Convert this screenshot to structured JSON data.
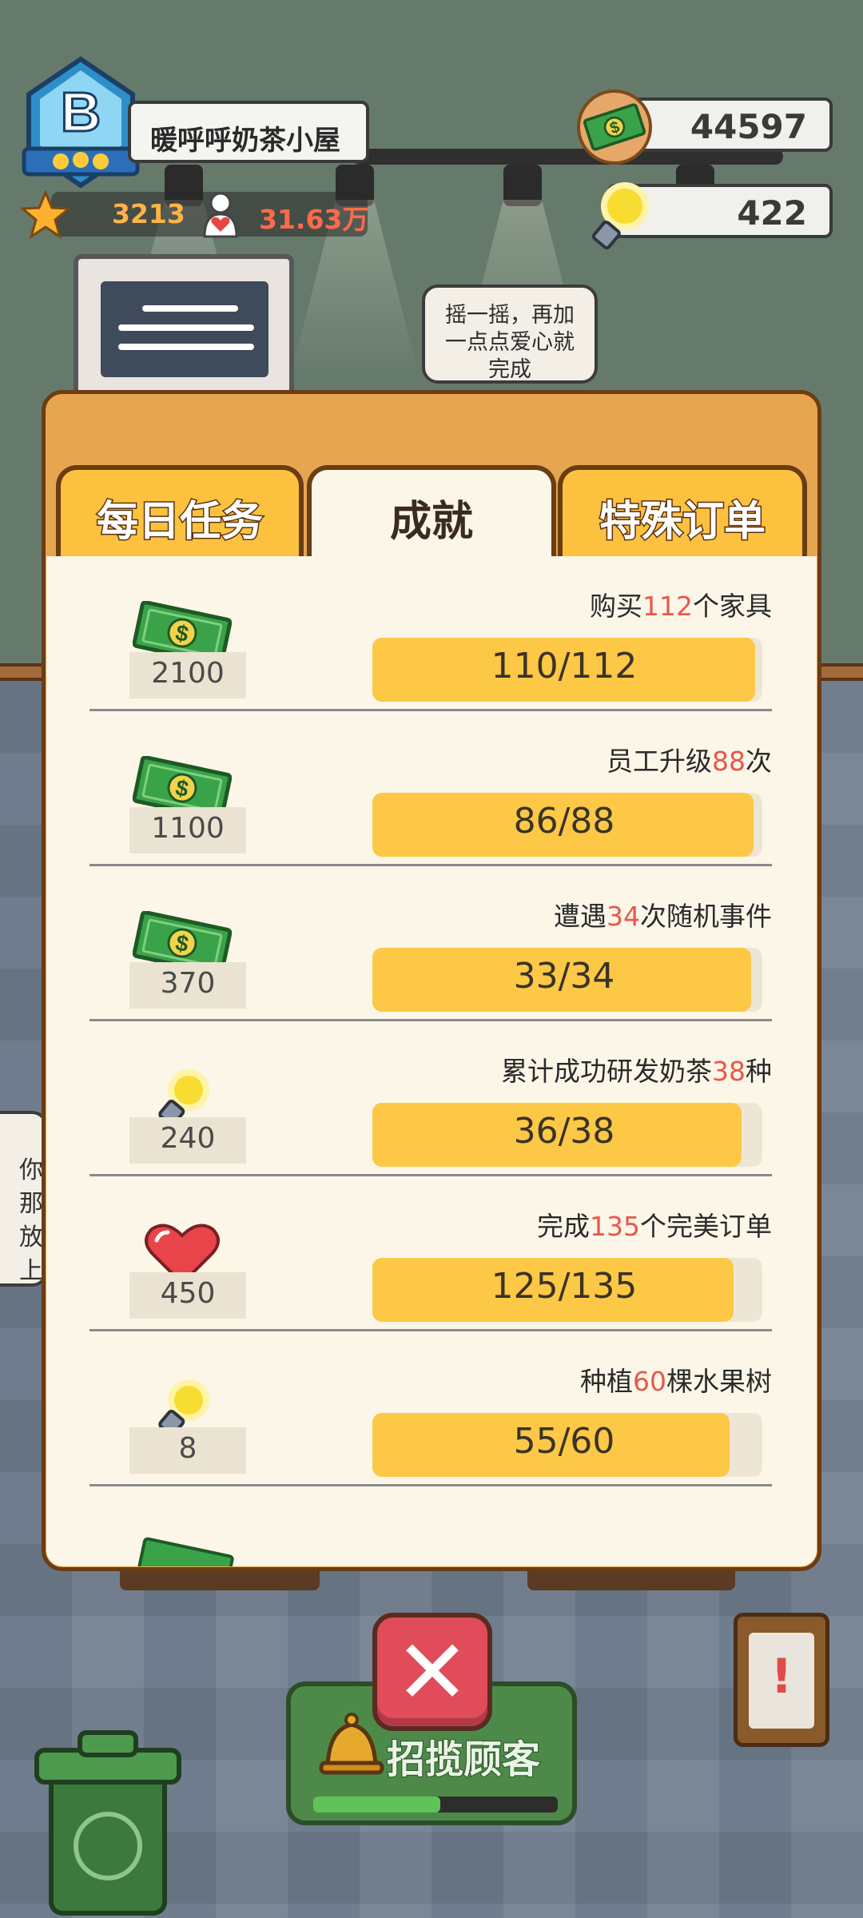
{
  "header": {
    "rank_letter": "B",
    "shop_name": "暖呼呼奶茶小屋",
    "stars": "3213",
    "fans": "31.63万",
    "coins": "44597",
    "ideas": "422"
  },
  "scene": {
    "speech_bubble": "摇一摇，再加一点点爱心就完成",
    "left_bubble": "你\n那\n放\n上"
  },
  "tabs": [
    {
      "label": "每日任务",
      "active": false
    },
    {
      "label": "成就",
      "active": true
    },
    {
      "label": "特殊订单",
      "active": false
    }
  ],
  "achievements": [
    {
      "reward_icon": "cash-icon",
      "reward": "2100",
      "title_pre": "购买",
      "title_num": "112",
      "title_post": "个家具",
      "progress_text": "110/112",
      "progress": 0.982
    },
    {
      "reward_icon": "cash-icon",
      "reward": "1100",
      "title_pre": "员工升级",
      "title_num": "88",
      "title_post": "次",
      "progress_text": "86/88",
      "progress": 0.977
    },
    {
      "reward_icon": "cash-icon",
      "reward": "370",
      "title_pre": "遭遇",
      "title_num": "34",
      "title_post": "次随机事件",
      "progress_text": "33/34",
      "progress": 0.971
    },
    {
      "reward_icon": "lightbulb-icon",
      "reward": "240",
      "title_pre": "累计成功研发奶茶",
      "title_num": "38",
      "title_post": "种",
      "progress_text": "36/38",
      "progress": 0.947
    },
    {
      "reward_icon": "heart-icon",
      "reward": "450",
      "title_pre": "完成",
      "title_num": "135",
      "title_post": "个完美订单",
      "progress_text": "125/135",
      "progress": 0.926
    },
    {
      "reward_icon": "lightbulb-icon",
      "reward": "8",
      "title_pre": "种植",
      "title_num": "60",
      "title_post": "棵水果树",
      "progress_text": "55/60",
      "progress": 0.917
    }
  ],
  "close_label": "✕",
  "call_button": {
    "label": "招揽顾客",
    "progress": 0.52
  },
  "colors": {
    "panel": "#fbf6e8",
    "frame": "#e6a54f",
    "bar": "#fcc846",
    "accent_number": "#e8584a"
  }
}
